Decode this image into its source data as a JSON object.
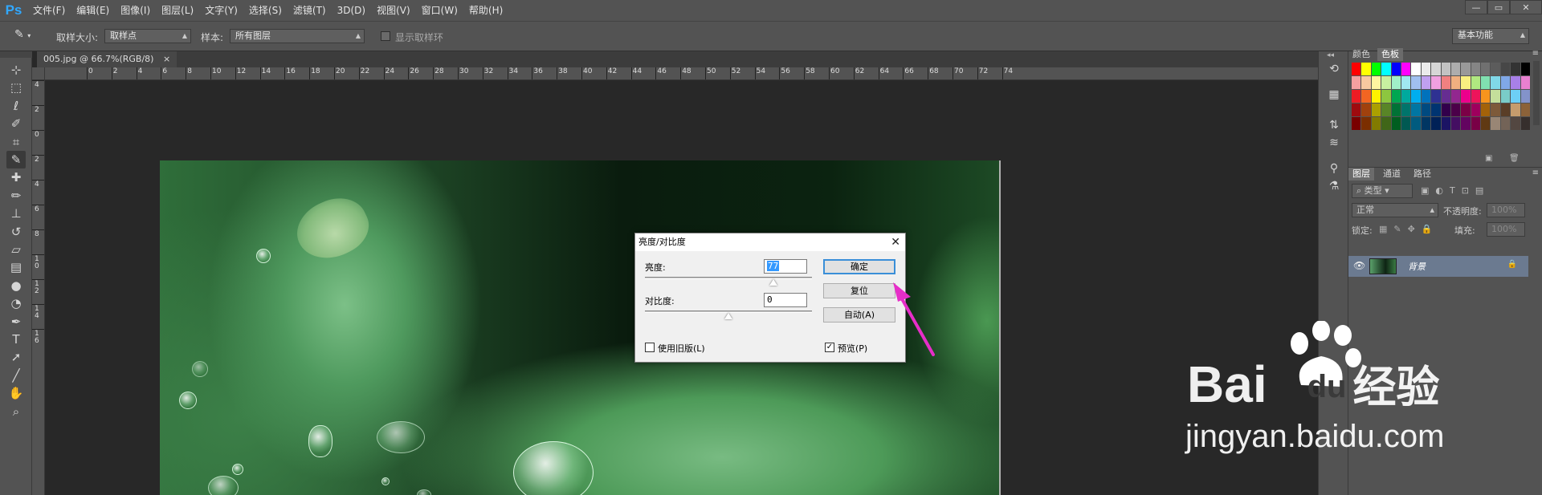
{
  "app": {
    "logo": "Ps"
  },
  "menu": [
    "文件(F)",
    "编辑(E)",
    "图像(I)",
    "图层(L)",
    "文字(Y)",
    "选择(S)",
    "滤镜(T)",
    "3D(D)",
    "视图(V)",
    "窗口(W)",
    "帮助(H)"
  ],
  "window_controls": [
    "—",
    "▭",
    "✕"
  ],
  "options": {
    "sample_size_label": "取样大小:",
    "sample_size_value": "取样点",
    "sample_label": "样本:",
    "sample_value": "所有图层",
    "show_ring_label": "显示取样环",
    "workspace": "基本功能"
  },
  "document_tab": {
    "title": "005.jpg @ 66.7%(RGB/8)",
    "close": "×"
  },
  "ruler_h_ticks": [
    "0",
    "2",
    "4",
    "6",
    "8",
    "10",
    "12",
    "14",
    "16",
    "18",
    "20",
    "22",
    "24",
    "26",
    "28",
    "30",
    "32",
    "34",
    "36",
    "38",
    "40",
    "42",
    "44",
    "46",
    "48",
    "50",
    "52",
    "54",
    "56",
    "58",
    "60",
    "62",
    "64",
    "66",
    "68",
    "70",
    "72",
    "74"
  ],
  "ruler_v_ticks": [
    "4",
    "2",
    "0",
    "2",
    "4",
    "6",
    "8",
    "1 0",
    "1 2",
    "1 4",
    "1 6"
  ],
  "tools": [
    "move-tool",
    "marquee-tool",
    "lasso-tool",
    "quick-select-tool",
    "crop-tool",
    "eyedropper-tool",
    "healing-tool",
    "brush-tool",
    "stamp-tool",
    "history-brush-tool",
    "eraser-tool",
    "gradient-tool",
    "blur-tool",
    "dodge-tool",
    "pen-tool",
    "type-tool",
    "path-select-tool",
    "shape-tool",
    "hand-tool",
    "zoom-tool"
  ],
  "dialog": {
    "title": "亮度/对比度",
    "close": "✕",
    "brightness_label": "亮度:",
    "brightness_value": "77",
    "brightness_level": 0.77,
    "contrast_label": "对比度:",
    "contrast_value": "0",
    "contrast_level": 0.5,
    "legacy_label": "使用旧版(L)",
    "legacy_checked": false,
    "ok": "确定",
    "reset": "复位",
    "auto": "自动(A)",
    "preview_label": "预览(P)",
    "preview_checked": true
  },
  "panels": {
    "color_tab": "颜色",
    "swatches_tab": "色板",
    "layers_tab": "图层",
    "channels_tab": "通道",
    "paths_tab": "路径",
    "filter_kind": "类型",
    "blend_mode": "正常",
    "opacity_label": "不透明度:",
    "opacity_value": "100%",
    "lock_label": "锁定:",
    "fill_label": "填充:",
    "fill_value": "100%",
    "layer_name": "背景"
  },
  "swatch_colors": [
    "#ff0000",
    "#ffff00",
    "#00ff00",
    "#00ffff",
    "#0000ff",
    "#ff00ff",
    "#ffffff",
    "#ebebeb",
    "#d6d6d6",
    "#c2c2c2",
    "#adadad",
    "#999999",
    "#858585",
    "#707070",
    "#5c5c5c",
    "#474747",
    "#333333",
    "#000000",
    "#f4a0a0",
    "#f8c8a0",
    "#fff5a0",
    "#c8f0a0",
    "#a0f0c8",
    "#a0e8f0",
    "#a0c0f0",
    "#c0a0f0",
    "#f0a0e0",
    "#f08080",
    "#f0b080",
    "#f8f080",
    "#b0e880",
    "#80e0b0",
    "#80d8e8",
    "#80a8e8",
    "#a880e8",
    "#e880d0",
    "#ed1c24",
    "#f26522",
    "#fff200",
    "#8dc63f",
    "#00a651",
    "#00a99d",
    "#00aeef",
    "#0072bc",
    "#2e3192",
    "#662d91",
    "#92278f",
    "#ec008c",
    "#ed145b",
    "#f7941d",
    "#c4df9b",
    "#7accc8",
    "#6dcff6",
    "#8393ca",
    "#9e0b0f",
    "#a0410d",
    "#aba000",
    "#598527",
    "#007236",
    "#00746b",
    "#0076a3",
    "#004a80",
    "#003471",
    "#32004b",
    "#4b0049",
    "#7b0046",
    "#9e005d",
    "#a36209",
    "#7d5a3a",
    "#5a3e27",
    "#c69c6d",
    "#8c6239",
    "#790000",
    "#7b2e00",
    "#827b00",
    "#406618",
    "#005e20",
    "#005952",
    "#005b7f",
    "#003663",
    "#002157",
    "#1b1464",
    "#440e62",
    "#630460",
    "#790046",
    "#603913",
    "#998675",
    "#736357",
    "#534741",
    "#362f2d"
  ],
  "watermark": {
    "brand_left": "Bai",
    "brand_mid": "du",
    "brand_right": "经验",
    "url": "jingyan.baidu.com"
  }
}
